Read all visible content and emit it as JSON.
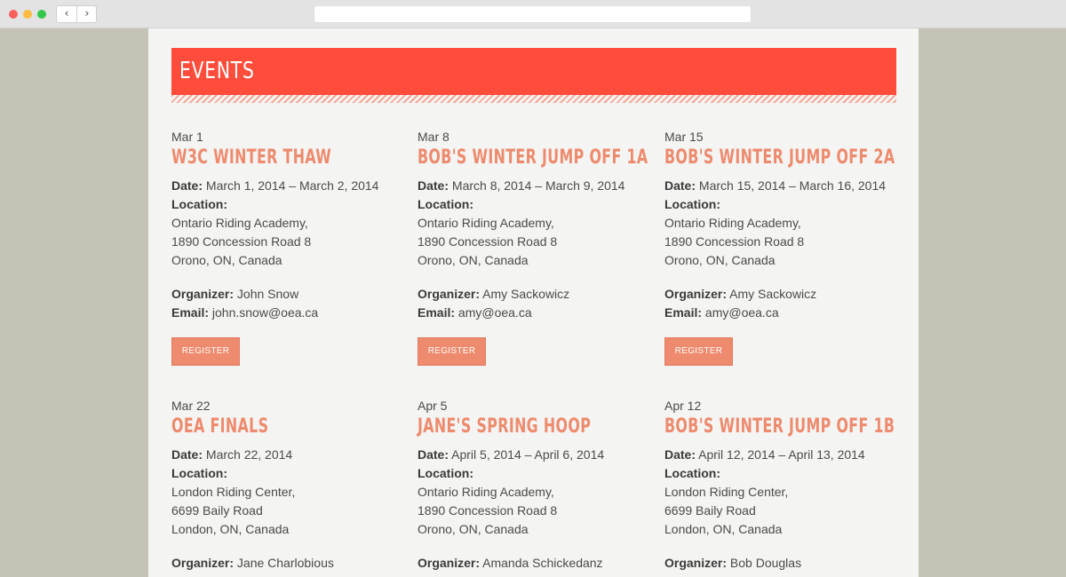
{
  "browser": {
    "back_icon": "‹",
    "forward_icon": "›",
    "address": ""
  },
  "page": {
    "banner_title": "EVENTS"
  },
  "labels": {
    "date": "Date:",
    "location": "Location:",
    "organizer": "Organizer:",
    "email": "Email:",
    "register": "REGISTER"
  },
  "events": [
    {
      "short_date": "Mar 1",
      "title": "W3C Winter Thaw",
      "date": "March 1, 2014 – March 2, 2014",
      "venue": "Ontario Riding Academy,",
      "street": "1890 Concession Road 8",
      "city": "Orono, ON, Canada",
      "organizer": "John Snow",
      "email": "john.snow@oea.ca"
    },
    {
      "short_date": "Mar 8",
      "title": "Bob's Winter Jump Off 1A",
      "date": "March 8, 2014 – March 9, 2014",
      "venue": "Ontario Riding Academy,",
      "street": "1890 Concession Road 8",
      "city": "Orono, ON, Canada",
      "organizer": "Amy Sackowicz",
      "email": "amy@oea.ca"
    },
    {
      "short_date": "Mar 15",
      "title": "Bob's Winter Jump Off 2A",
      "date": "March 15, 2014 – March 16, 2014",
      "venue": "Ontario Riding Academy,",
      "street": "1890 Concession Road 8",
      "city": "Orono, ON, Canada",
      "organizer": "Amy Sackowicz",
      "email": "amy@oea.ca"
    },
    {
      "short_date": "Mar 22",
      "title": "OEA Finals",
      "date": "March 22, 2014",
      "venue": "London Riding Center,",
      "street": "6699 Baily Road",
      "city": "London, ON, Canada",
      "organizer": "Jane Charlobious"
    },
    {
      "short_date": "Apr 5",
      "title": "Jane's Spring Hoop",
      "date": "April 5, 2014 – April 6, 2014",
      "venue": "Ontario Riding Academy,",
      "street": "1890 Concession Road 8",
      "city": "Orono, ON, Canada",
      "organizer": "Amanda Schickedanz"
    },
    {
      "short_date": "Apr 12",
      "title": "Bob's Winter Jump Off 1B",
      "date": "April 12, 2014 – April 13, 2014",
      "venue": "London Riding Center,",
      "street": "6699 Baily Road",
      "city": "London, ON, Canada",
      "organizer": "Bob Douglas"
    }
  ]
}
